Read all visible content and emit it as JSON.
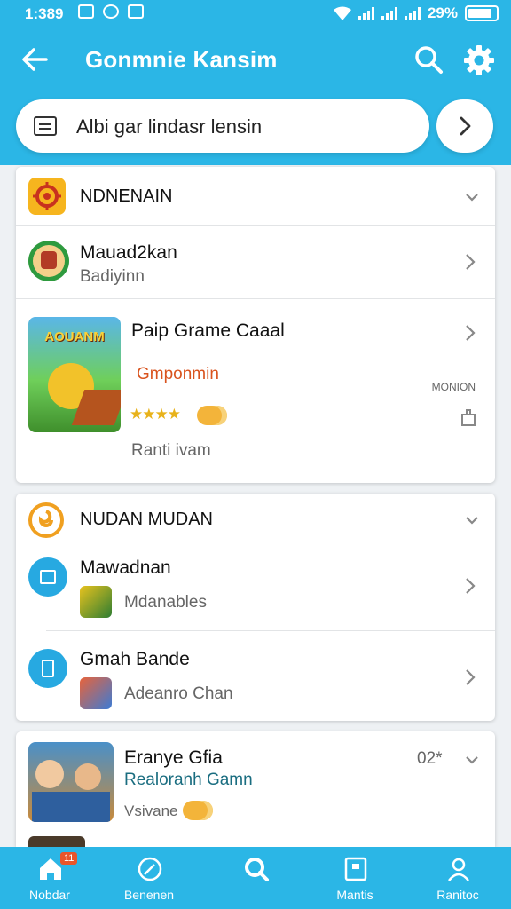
{
  "status": {
    "time": "1:389",
    "battery": "29%"
  },
  "appbar": {
    "title": "Gonmnie Kansim"
  },
  "search": {
    "text": "Albi gar lindasr lensin"
  },
  "section1": {
    "header": "NDNENAIN",
    "row1": {
      "name": "Mauad2kan",
      "sub": "Badiyinn"
    },
    "featured": {
      "title": "Paip Grame Caaal",
      "badge": "Gmponmin",
      "tag": "MONION",
      "rating_text": "Ranti ivam",
      "stars": 4,
      "thumb_text": "AOUANM"
    }
  },
  "section2": {
    "header": "NUDAN MUDAN",
    "row1": {
      "name": "Mawadnan",
      "sub": "Mdanables"
    },
    "row2": {
      "name": "Gmah Bande",
      "sub": "Adeanro Chan"
    }
  },
  "section3": {
    "row1": {
      "name": "Eranye Gfia",
      "sub": "Realoranh Gamn",
      "value": "Vsivane",
      "count": "02*"
    }
  },
  "nav": [
    {
      "label": "Nobdar",
      "badge": "11"
    },
    {
      "label": "Benenen"
    },
    {
      "label": ""
    },
    {
      "label": "Mantis"
    },
    {
      "label": "Ranitoc"
    }
  ],
  "colors": {
    "primary": "#2bb6e6",
    "accent": "#f0a020",
    "badge_text": "#d9531e",
    "link_text": "#1a6d80"
  }
}
